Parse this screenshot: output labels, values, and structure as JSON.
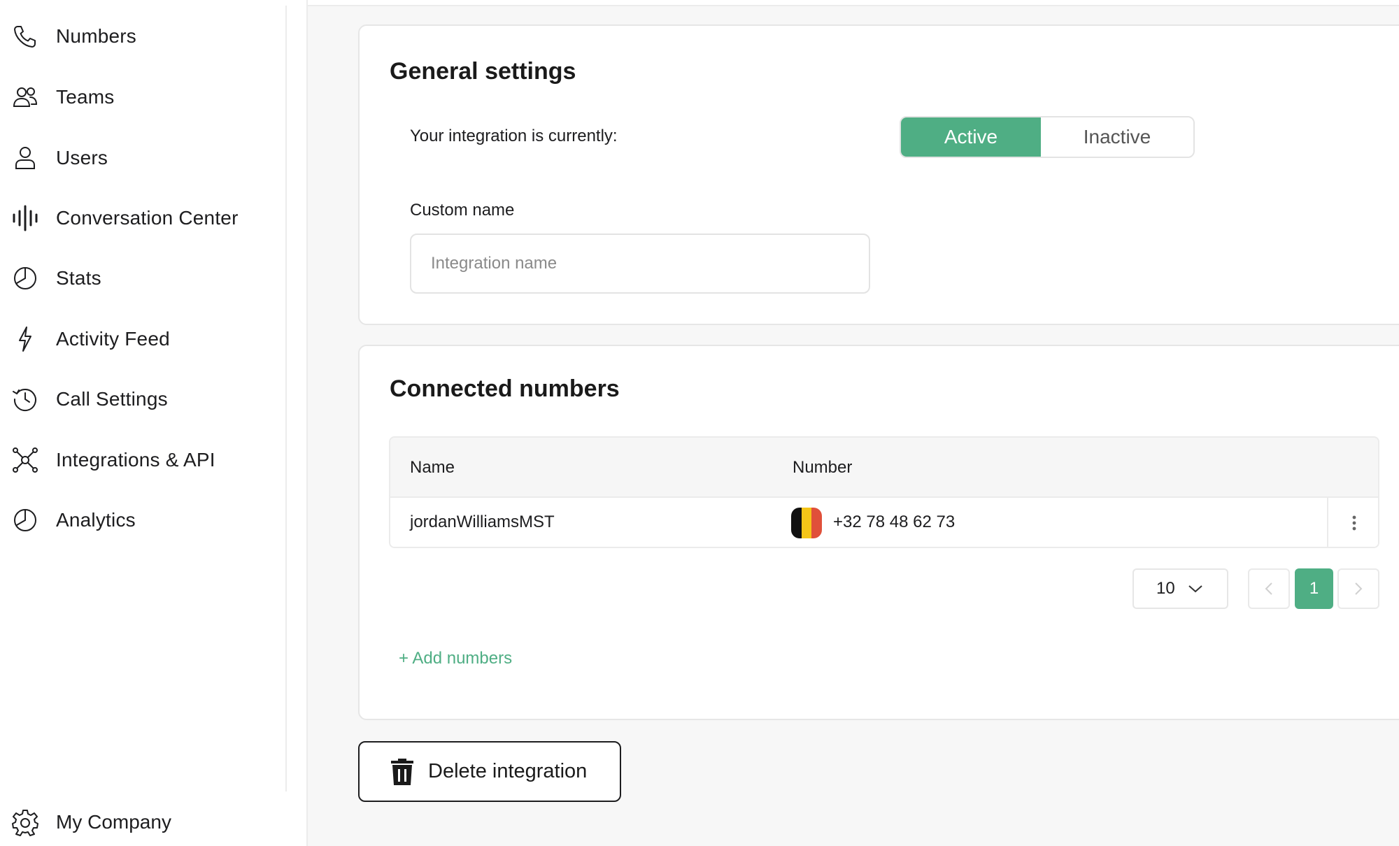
{
  "sidebar": {
    "items": [
      {
        "label": "Numbers",
        "icon": "phone-icon"
      },
      {
        "label": "Teams",
        "icon": "team-icon"
      },
      {
        "label": "Users",
        "icon": "user-icon"
      },
      {
        "label": "Conversation Center",
        "icon": "waveform-icon"
      },
      {
        "label": "Stats",
        "icon": "pie-chart-icon"
      },
      {
        "label": "Activity Feed",
        "icon": "lightning-icon"
      },
      {
        "label": "Call Settings",
        "icon": "history-icon"
      },
      {
        "label": "Integrations & API",
        "icon": "network-icon"
      },
      {
        "label": "Analytics",
        "icon": "pie-chart-icon"
      }
    ],
    "company": {
      "label": "My Company",
      "icon": "gear-icon"
    }
  },
  "general": {
    "title": "General settings",
    "status_label": "Your integration is currently:",
    "toggle": {
      "active": "Active",
      "inactive": "Inactive",
      "selected": "Active"
    },
    "custom_name_label": "Custom name",
    "custom_name_value": "",
    "custom_name_placeholder": "Integration name"
  },
  "numbers": {
    "title": "Connected numbers",
    "columns": {
      "name": "Name",
      "number": "Number"
    },
    "rows": [
      {
        "name": "jordanWilliamsMST",
        "number": "+32 78 48 62 73",
        "flag_colors": [
          "#111111",
          "#f5c518",
          "#e0503a"
        ]
      }
    ],
    "page_size": "10",
    "current_page": "1",
    "add_label": "+ Add numbers"
  },
  "actions": {
    "delete_label": "Delete integration"
  },
  "colors": {
    "accent": "#4fae84"
  }
}
